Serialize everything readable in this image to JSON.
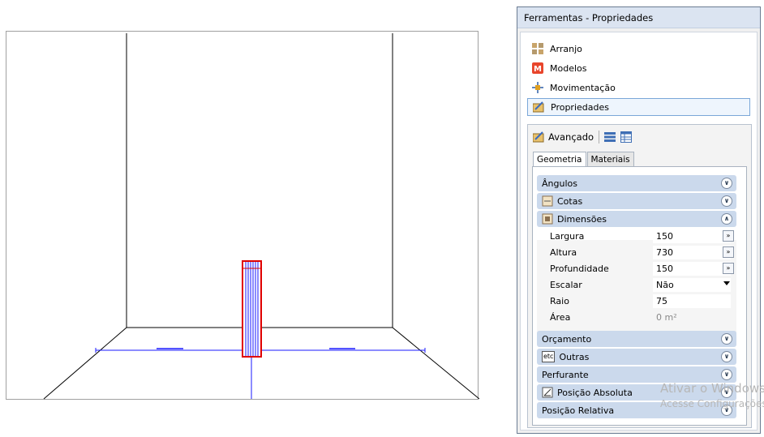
{
  "panel": {
    "title": "Ferramentas - Propriedades",
    "nav": [
      {
        "label": "Arranjo",
        "icon": "arrange-icon"
      },
      {
        "label": "Modelos",
        "icon": "models-icon"
      },
      {
        "label": "Movimentação",
        "icon": "move-icon"
      },
      {
        "label": "Propriedades",
        "icon": "properties-icon",
        "active": true
      }
    ],
    "advanced": {
      "label": "Avançado",
      "tabs": [
        "Geometria",
        "Materiais"
      ],
      "sections": {
        "angulos": "Ângulos",
        "cotas": "Cotas",
        "dimensoes": "Dimensões",
        "orcamento": "Orçamento",
        "outras": "Outras",
        "perfurante": "Perfurante",
        "posicao_absoluta": "Posição Absoluta",
        "posicao_relativa": "Posição Relativa"
      },
      "properties": {
        "largura": {
          "label": "Largura",
          "value": "150"
        },
        "altura": {
          "label": "Altura",
          "value": "730"
        },
        "profundidade": {
          "label": "Profundidade",
          "value": "150"
        },
        "escalar": {
          "label": "Escalar",
          "value": "Não"
        },
        "raio": {
          "label": "Raio",
          "value": "75"
        },
        "area": {
          "label": "Área",
          "value": "0 m²"
        }
      },
      "outras_badge": "etc",
      "expand_glyph": "»"
    }
  },
  "watermark": {
    "line1": "Ativar o Windows",
    "line2": "Acesse Configurações"
  },
  "colors": {
    "accent": "#cbd9ec",
    "wall_lines": "#000000",
    "object_blue": "#1a1aff",
    "object_red": "#e00000"
  }
}
